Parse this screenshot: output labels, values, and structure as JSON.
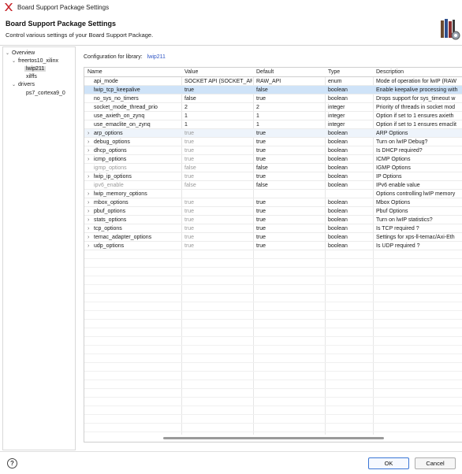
{
  "window": {
    "title": "Board Support Package Settings"
  },
  "header": {
    "title": "Board Support Package Settings",
    "subtitle": "Control various settings of your Board Support Package."
  },
  "tree": [
    {
      "label": "Overview",
      "depth": 0,
      "twisty": "down"
    },
    {
      "label": "freertos10_xilinx",
      "depth": 1,
      "twisty": "down"
    },
    {
      "label": "lwip211",
      "depth": 2,
      "twisty": "",
      "selected": true
    },
    {
      "label": "xilffs",
      "depth": 2,
      "twisty": ""
    },
    {
      "label": "drivers",
      "depth": 1,
      "twisty": "down"
    },
    {
      "label": "ps7_cortexa9_0",
      "depth": 2,
      "twisty": ""
    }
  ],
  "config": {
    "label": "Configuration for library:",
    "library": "lwip211"
  },
  "table": {
    "columns": [
      "Name",
      "Value",
      "Default",
      "Type",
      "Description"
    ],
    "rows": [
      {
        "name": "api_mode",
        "value": "SOCKET API (SOCKET_API)",
        "default": "RAW_API",
        "type": "enum",
        "desc": "Mode of operation for lwIP (RAW",
        "expandable": false
      },
      {
        "name": "lwip_tcp_keepalive",
        "value": "true",
        "default": "false",
        "type": "boolean",
        "desc": "Enable keepalive processing with",
        "expandable": false,
        "selected": true
      },
      {
        "name": "no_sys_no_timers",
        "value": "false",
        "default": "true",
        "type": "boolean",
        "desc": "Drops support for sys_timeout w",
        "expandable": false
      },
      {
        "name": "socket_mode_thread_prio",
        "value": "2",
        "default": "2",
        "type": "integer",
        "desc": "Priority of threads in socket mod",
        "expandable": false
      },
      {
        "name": "use_axieth_on_zynq",
        "value": "1",
        "default": "1",
        "type": "integer",
        "desc": "Option if set to 1 ensures axieth",
        "expandable": false
      },
      {
        "name": "use_emaclite_on_zynq",
        "value": "1",
        "default": "1",
        "type": "integer",
        "desc": "Option if set to 1 ensures emaclit",
        "expandable": false
      },
      {
        "name": "arp_options",
        "value": "true",
        "default": "true",
        "type": "boolean",
        "desc": "ARP Options",
        "expandable": true,
        "grey_value": true,
        "alt": true
      },
      {
        "name": "debug_options",
        "value": "true",
        "default": "true",
        "type": "boolean",
        "desc": "Turn on lwIP Debug?",
        "expandable": true,
        "grey_value": true
      },
      {
        "name": "dhcp_options",
        "value": "true",
        "default": "true",
        "type": "boolean",
        "desc": "Is DHCP required?",
        "expandable": true,
        "grey_value": true
      },
      {
        "name": "icmp_options",
        "value": "true",
        "default": "true",
        "type": "boolean",
        "desc": "ICMP Options",
        "expandable": true,
        "grey_value": true
      },
      {
        "name": "igmp_options",
        "value": "false",
        "default": "false",
        "type": "boolean",
        "desc": "IGMP Options",
        "expandable": false,
        "grey_name": true
      },
      {
        "name": "lwip_ip_options",
        "value": "true",
        "default": "true",
        "type": "boolean",
        "desc": "IP Options",
        "expandable": true,
        "grey_value": true
      },
      {
        "name": "ipv6_enable",
        "value": "false",
        "default": "false",
        "type": "boolean",
        "desc": "IPv6 enable value",
        "expandable": false,
        "grey_name": true
      },
      {
        "name": "lwip_memory_options",
        "value": "",
        "default": "",
        "type": "",
        "desc": "Options controlling lwIP memory",
        "expandable": true
      },
      {
        "name": "mbox_options",
        "value": "true",
        "default": "true",
        "type": "boolean",
        "desc": "Mbox Options",
        "expandable": true,
        "grey_value": true
      },
      {
        "name": "pbuf_options",
        "value": "true",
        "default": "true",
        "type": "boolean",
        "desc": "Pbuf Options",
        "expandable": true,
        "grey_value": true
      },
      {
        "name": "stats_options",
        "value": "true",
        "default": "true",
        "type": "boolean",
        "desc": "Turn on lwIP statistics?",
        "expandable": true,
        "grey_value": true
      },
      {
        "name": "tcp_options",
        "value": "true",
        "default": "true",
        "type": "boolean",
        "desc": "Is TCP required ?",
        "expandable": true,
        "grey_value": true
      },
      {
        "name": "temac_adapter_options",
        "value": "true",
        "default": "true",
        "type": "boolean",
        "desc": "Settings for xps-ll-temac/Axi-Eth",
        "expandable": true,
        "grey_value": true
      },
      {
        "name": "udp_options",
        "value": "true",
        "default": "true",
        "type": "boolean",
        "desc": "Is UDP required ?",
        "expandable": true,
        "grey_value": true
      }
    ]
  },
  "footer": {
    "help": "?",
    "ok": "OK",
    "cancel": "Cancel"
  },
  "colors": {
    "selected_row": "#cfe3f8",
    "accent": "#3b76d6",
    "link": "#2f55c4"
  }
}
